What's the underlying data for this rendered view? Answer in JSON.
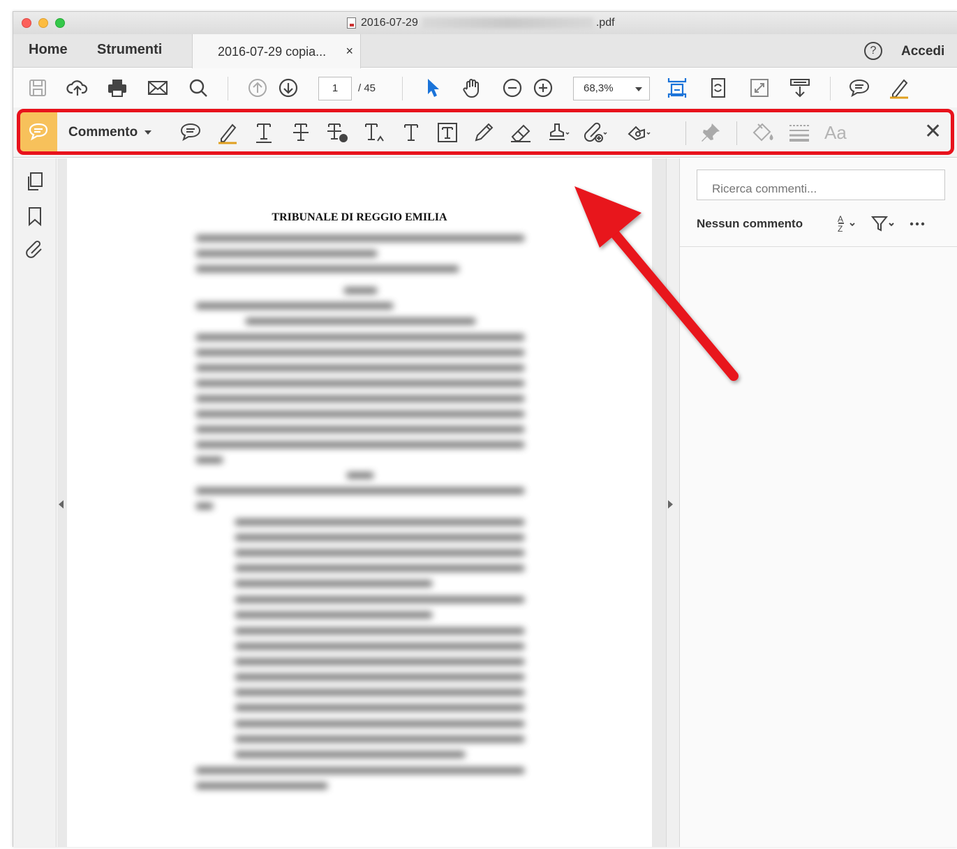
{
  "window": {
    "title_start": "2016-07-29",
    "title_end": ".pdf"
  },
  "tabs": {
    "home": "Home",
    "tools": "Strumenti",
    "document": "2016-07-29 copia...",
    "document_close": "×",
    "help": "?",
    "sign_in": "Accedi"
  },
  "toolbar": {
    "page_current": "1",
    "page_total": "/ 45",
    "zoom": "68,3%"
  },
  "comment_toolbar": {
    "label": "Commento",
    "font_button": "Aa",
    "close": "✕"
  },
  "document": {
    "heading": "TRIBUNALE DI REGGIO EMILIA"
  },
  "comments_pane": {
    "search_placeholder": "Ricerca commenti...",
    "empty_label": "Nessun commento"
  },
  "colors": {
    "highlight_border": "#e8121c",
    "active_tool": "#f7c15b",
    "accent_blue": "#1a73d9"
  }
}
